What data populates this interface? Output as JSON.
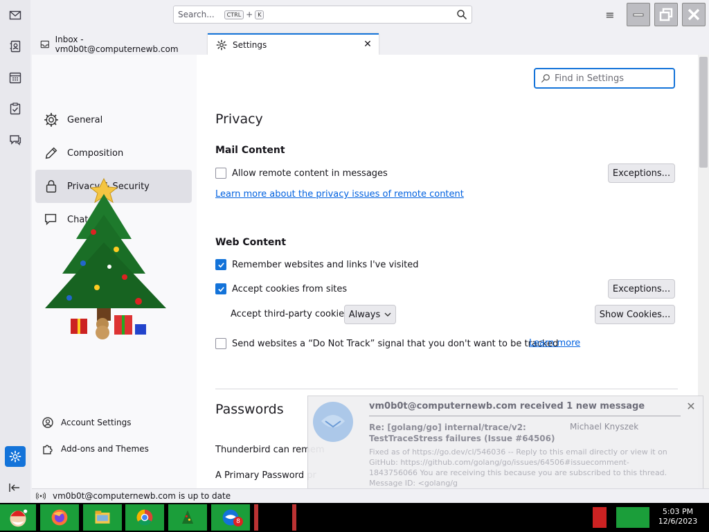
{
  "titlebar": {
    "search_placeholder": "Search...",
    "search_key1": "CTRL",
    "search_plus": "+",
    "search_key2": "K"
  },
  "tabs": [
    {
      "label": "Inbox - vm0b0t@computernewb.com"
    },
    {
      "label": "Settings"
    }
  ],
  "sidebar": {
    "categories": [
      {
        "label": "General",
        "icon": "gear-icon"
      },
      {
        "label": "Composition",
        "icon": "pencil-icon"
      },
      {
        "label": "Privacy & Security",
        "icon": "lock-icon"
      },
      {
        "label": "Chat",
        "icon": "chat-icon"
      }
    ],
    "account_settings": "Account Settings",
    "addons": "Add-ons and Themes"
  },
  "main": {
    "find_placeholder": "Find in Settings",
    "privacy_heading": "Privacy",
    "mail_content_heading": "Mail Content",
    "allow_remote": "Allow remote content in messages",
    "exceptions_label": "Exceptions...",
    "learn_remote": "Learn more about the privacy issues of remote content",
    "web_content_heading": "Web Content",
    "remember_sites": "Remember websites and links I've visited",
    "accept_cookies": "Accept cookies from sites",
    "third_party_label": "Accept third-party cookies:",
    "third_party_value": "Always",
    "show_cookies": "Show Cookies...",
    "dnt": "Send websites a “Do Not Track” signal that you don't want to be tracked",
    "learn_more": "Learn more",
    "passwords_heading": "Passwords",
    "tb_remember": "Thunderbird can remem",
    "primary_pw": "A Primary Password pr"
  },
  "notification": {
    "title": "vm0b0t@computernewb.com received 1 new message",
    "subject": "Re: [golang/go] internal/trace/v2: TestTraceStress failures (Issue #64506)",
    "from": "Michael Knyszek",
    "body": "Fixed as of https://go.dev/cl/546036 -- Reply to this email directly or view it on GitHub: https://github.com/golang/go/issues/64506#issuecomment-1843756066 You are receiving this because you are subscribed to this thread. Message ID: <golang/g"
  },
  "status": {
    "text": "vm0b0t@computernewb.com is up to date"
  },
  "taskbar": {
    "time": "5:03 PM",
    "date": "12/6/2023",
    "badge": "8"
  },
  "colors": {
    "accent": "#1373d9",
    "link": "#0061e0"
  }
}
